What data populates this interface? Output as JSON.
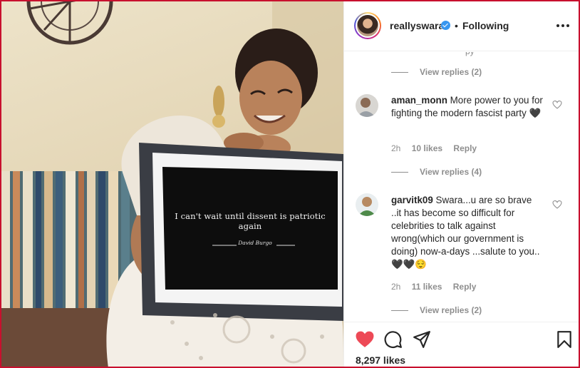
{
  "photo": {
    "quote_text": "I can't wait until dissent is patriotic again",
    "quote_author": "David Burgo"
  },
  "header": {
    "username": "reallyswara",
    "separator": "•",
    "follow_status": "Following",
    "more_icon": "more-horizontal-icon"
  },
  "comments": {
    "top_view_replies": "View replies (2)",
    "items": [
      {
        "username": "aman_monn",
        "text": "More power to you for fighting the modern fascist party 🖤",
        "time": "2h",
        "likes": "10 likes",
        "reply": "Reply",
        "view_replies": "View replies (4)"
      },
      {
        "username": "garvitk09",
        "text": "Swara...u are so brave ..it has become so difficult for celebrities to talk against wrong(which our government is doing) now-a-days ...salute to you..🖤🖤😌",
        "time": "2h",
        "likes": "11 likes",
        "reply": "Reply",
        "view_replies": "View replies (2)"
      }
    ]
  },
  "actions": {
    "like_icon": "heart-filled-icon",
    "comment_icon": "comment-icon",
    "share_icon": "share-icon",
    "save_icon": "bookmark-icon",
    "like_color": "#ed4956",
    "likes_count": "8,297 likes"
  },
  "colors": {
    "border": "#c8102e",
    "verified": "#3897f0",
    "muted": "#8e8e8e"
  }
}
